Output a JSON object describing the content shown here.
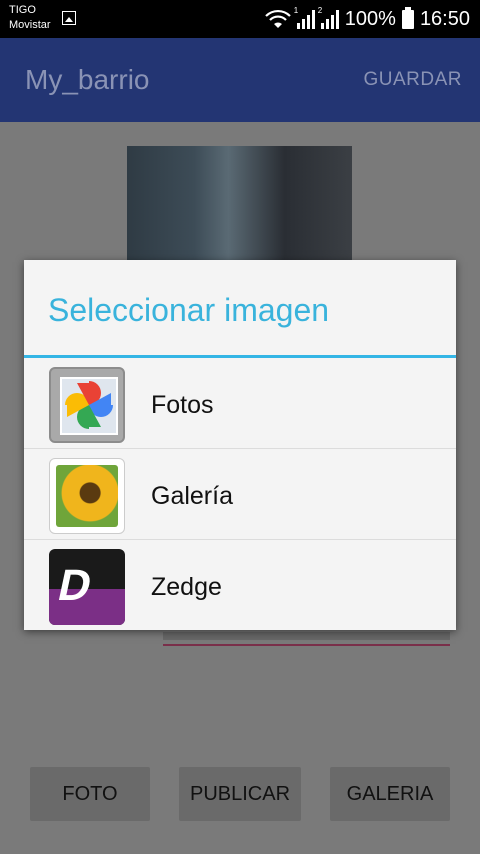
{
  "status_bar": {
    "carrier1": "TIGO",
    "carrier2": "Movistar",
    "sim1": "1",
    "sim2": "2",
    "battery_percent": "100%",
    "time": "16:50",
    "icons": [
      "image-icon",
      "wifi-icon",
      "signal-sim1-icon",
      "signal-sim2-icon",
      "battery-icon"
    ]
  },
  "app_bar": {
    "title": "My_barrio",
    "save_label": "GUARDAR"
  },
  "dialog": {
    "title": "Seleccionar imagen",
    "accent_color": "#33b5e5",
    "options": [
      {
        "label": "Fotos",
        "icon": "google-photos-icon"
      },
      {
        "label": "Galería",
        "icon": "gallery-sunflower-icon"
      },
      {
        "label": "Zedge",
        "icon": "zedge-icon"
      }
    ]
  },
  "buttons": {
    "foto": "FOTO",
    "publicar": "PUBLICAR",
    "galeria": "GALERIA"
  },
  "colors": {
    "app_bar": "#233573",
    "dialog_title": "#39b3dc",
    "input_underline": "#7a2f4a"
  }
}
